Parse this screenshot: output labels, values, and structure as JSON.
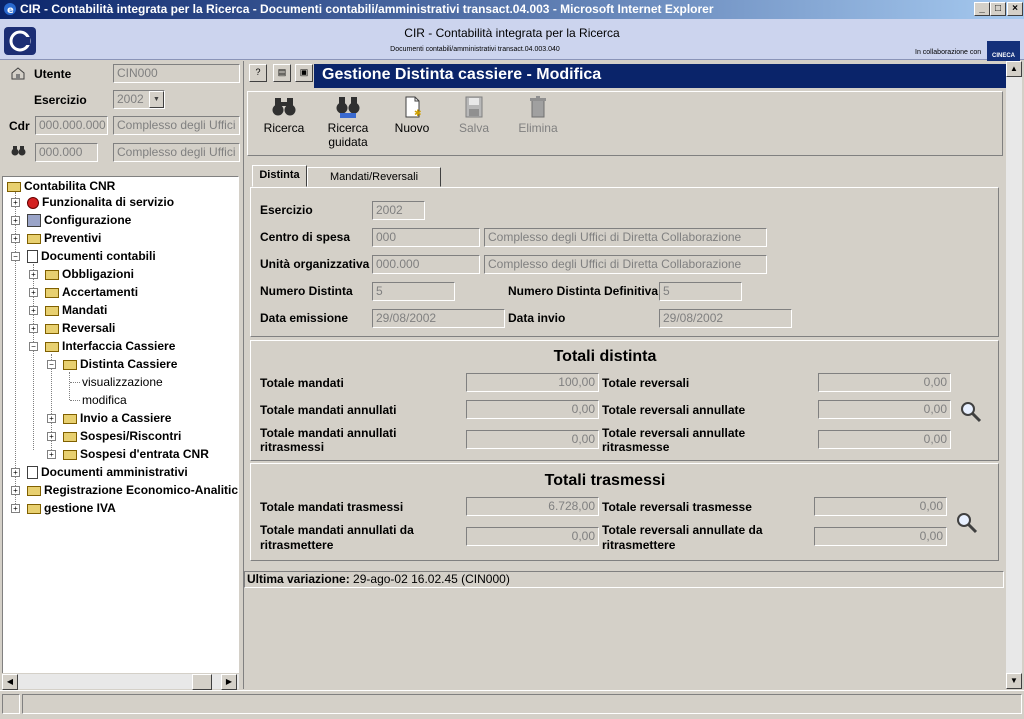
{
  "window": {
    "title": "CIR - Contabilità integrata per la Ricerca - Documenti contabili/amministrativi transact.04.003 - Microsoft Internet Explorer",
    "min": "_",
    "max": "□",
    "close": "×"
  },
  "header": {
    "title": "CIR - Contabilità integrata per la Ricerca",
    "subtitle": "Documenti contabili/amministrativi transact.04.003.040",
    "collab": "In collaborazione con",
    "cineca": "CINECA"
  },
  "left": {
    "utente_label": "Utente",
    "utente_value": "CIN000",
    "esercizio_label": "Esercizio",
    "esercizio_value": "2002",
    "cdr_label": "Cdr",
    "cdr_code": "000.000.000",
    "cdr_desc": "Complesso degli Uffici",
    "uo_code": "000.000",
    "uo_desc": "Complesso degli Uffici"
  },
  "tree": {
    "root": "Contabilita CNR",
    "items": [
      {
        "label": "Funzionalita di servizio"
      },
      {
        "label": "Configurazione"
      },
      {
        "label": "Preventivi"
      },
      {
        "label": "Documenti contabili"
      },
      {
        "label": "Obbligazioni"
      },
      {
        "label": "Accertamenti"
      },
      {
        "label": "Mandati"
      },
      {
        "label": "Reversali"
      },
      {
        "label": "Interfaccia Cassiere"
      },
      {
        "label": "Distinta Cassiere"
      },
      {
        "label": "visualizzazione"
      },
      {
        "label": "modifica"
      },
      {
        "label": "Invio a Cassiere"
      },
      {
        "label": "Sospesi/Riscontri"
      },
      {
        "label": "Sospesi d'entrata CNR"
      },
      {
        "label": "Documenti amministrativi"
      },
      {
        "label": "Registrazione Economico-Analitica"
      },
      {
        "label": "gestione IVA"
      }
    ]
  },
  "main": {
    "title": "Gestione Distinta cassiere - Modifica",
    "toolbar": {
      "ricerca": "Ricerca",
      "ricerca_guidata_1": "Ricerca",
      "ricerca_guidata_2": "guidata",
      "nuovo": "Nuovo",
      "salva": "Salva",
      "elimina": "Elimina"
    },
    "tabs": [
      "Distinta",
      "Mandati/Reversali"
    ],
    "form": {
      "esercizio_label": "Esercizio",
      "esercizio_value": "2002",
      "centro_label": "Centro di spesa",
      "centro_code": "000",
      "centro_desc": "Complesso degli Uffici di Diretta Collaborazione",
      "uo_label": "Unità organizzativa",
      "uo_code": "000.000",
      "uo_desc": "Complesso degli Uffici di Diretta Collaborazione",
      "numero_label": "Numero Distinta",
      "numero_value": "5",
      "numero_def_label": "Numero Distinta Definitiva",
      "numero_def_value": "5",
      "data_emissione_label": "Data emissione",
      "data_emissione_value": "29/08/2002",
      "data_invio_label": "Data invio",
      "data_invio_value": "29/08/2002"
    },
    "totali_distinta": {
      "title": "Totali distinta",
      "tot_mandati_label": "Totale mandati",
      "tot_mandati_value": "100,00",
      "tot_reversali_label": "Totale reversali",
      "tot_reversali_value": "0,00",
      "tot_mand_ann_label": "Totale mandati annullati",
      "tot_mand_ann_value": "0,00",
      "tot_rev_ann_label": "Totale reversali annullate",
      "tot_rev_ann_value": "0,00",
      "tot_mand_ann_rit_label_1": "Totale mandati annullati",
      "tot_mand_ann_rit_label_2": "ritrasmessi",
      "tot_mand_ann_rit_value": "0,00",
      "tot_rev_ann_rit_label_1": "Totale reversali annullate",
      "tot_rev_ann_rit_label_2": "ritrasmesse",
      "tot_rev_ann_rit_value": "0,00"
    },
    "totali_trasmessi": {
      "title": "Totali trasmessi",
      "mand_tras_label": "Totale mandati trasmessi",
      "mand_tras_value": "6.728,00",
      "rev_tras_label": "Totale reversali trasmesse",
      "rev_tras_value": "0,00",
      "mand_ann_da_rit_label_1": "Totale mandati annullati da",
      "mand_ann_da_rit_label_2": "ritrasmettere",
      "mand_ann_da_rit_value": "0,00",
      "rev_ann_da_rit_label_1": "Totale reversali annullate da",
      "rev_ann_da_rit_label_2": "ritrasmettere",
      "rev_ann_da_rit_value": "0,00"
    },
    "ultima_label": "Ultima variazione:",
    "ultima_value": "29-ago-02 16.02.45 (CIN000)"
  }
}
